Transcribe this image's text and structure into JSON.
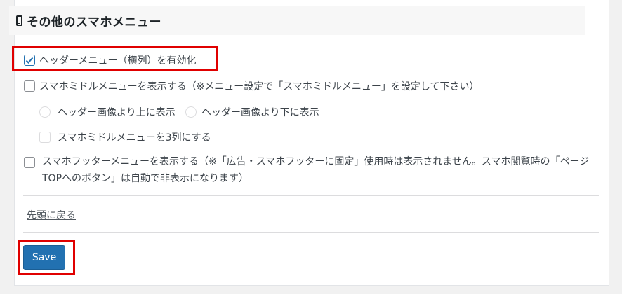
{
  "section": {
    "title": "その他のスマホメニュー",
    "icon": "smartphone-icon"
  },
  "options": {
    "horizontal_menu_label": "ヘッダーメニュー（横列）を有効化",
    "horizontal_menu_checked": true,
    "middle_menu_label": "スマホミドルメニューを表示する（※メニュー設定で「スマホミドルメニュー」を設定して下さい）",
    "middle_menu_checked": false,
    "position_above_label": "ヘッダー画像より上に表示",
    "position_below_label": "ヘッダー画像より下に表示",
    "three_columns_label": "スマホミドルメニューを3列にする",
    "footer_menu_label": "スマホフッターメニューを表示する（※「広告・スマホフッターに固定」使用時は表示されません。スマホ閲覧時の「ページTOPへのボタン」は自動で非表示になります）",
    "footer_menu_checked": false
  },
  "links": {
    "back_to_top": "先頭に戻る"
  },
  "actions": {
    "save_label": "Save"
  },
  "colors": {
    "accent": "#2271b1",
    "highlight": "#e00000"
  }
}
